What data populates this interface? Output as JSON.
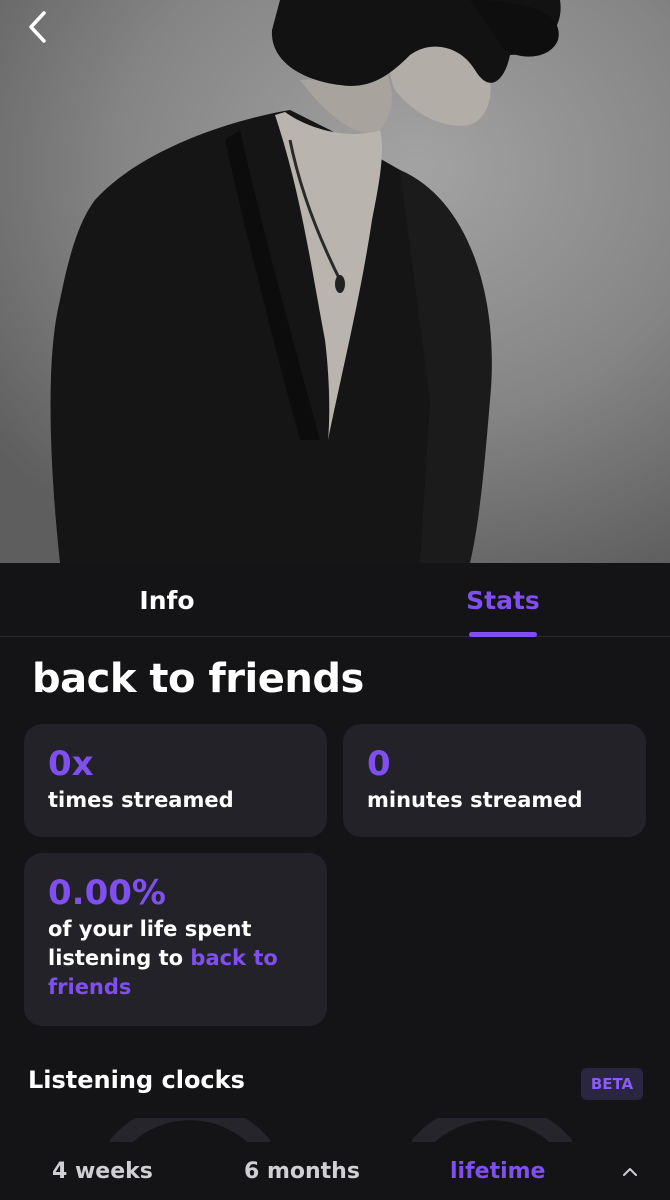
{
  "hero": {
    "alt": "artist-photo"
  },
  "tabs": [
    {
      "label": "Info",
      "active": false
    },
    {
      "label": "Stats",
      "active": true
    }
  ],
  "track": {
    "title": "back to friends"
  },
  "stats": {
    "times_streamed_value": "0x",
    "times_streamed_label": "times streamed",
    "minutes_streamed_value": "0",
    "minutes_streamed_label": "minutes streamed",
    "life_percent_value": "0.00%",
    "life_percent_label_prefix": "of your life spent listening to",
    "life_percent_label_track": "back to friends"
  },
  "listening_clocks": {
    "title": "Listening clocks",
    "badge": "BETA"
  },
  "ranges": {
    "items": [
      "4 weeks",
      "6 months",
      "lifetime"
    ],
    "selected": "lifetime"
  },
  "colors": {
    "accent": "#7f4ff0",
    "background": "#141416",
    "card": "#232228"
  },
  "icons": {
    "back": "chevron-left-icon",
    "collapse": "chevron-up-icon"
  }
}
